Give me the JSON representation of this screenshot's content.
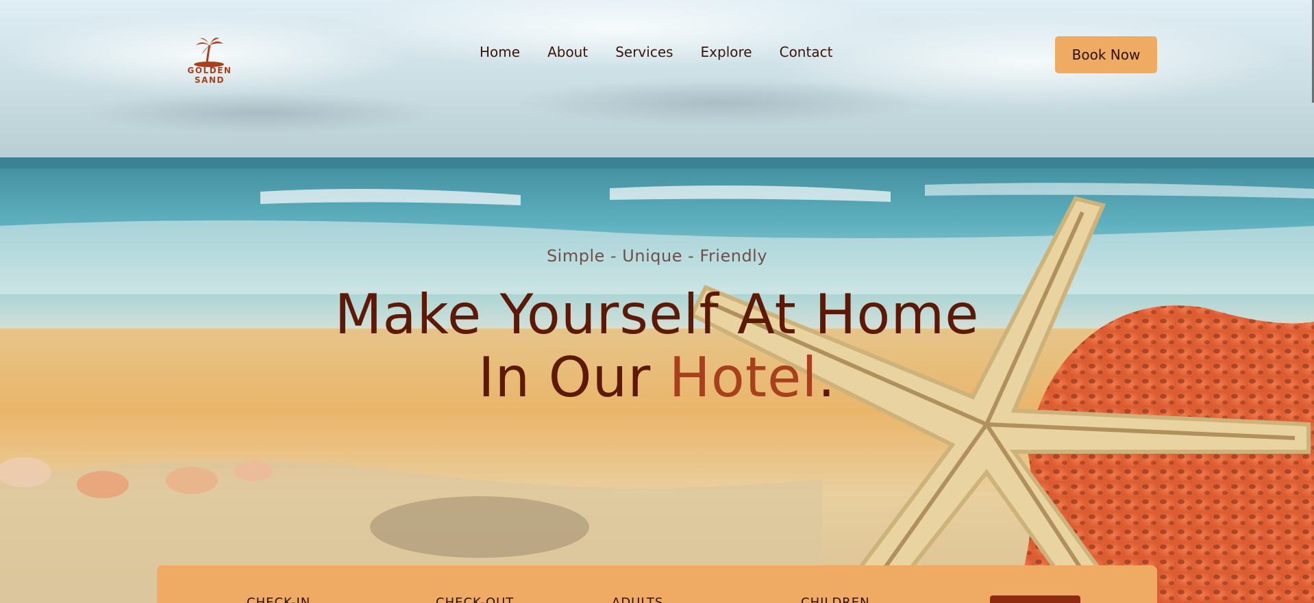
{
  "brand": {
    "name": "GOLDEN SAND",
    "color": "#a6401f",
    "icon": "palm-tree-island-icon"
  },
  "nav": {
    "items": [
      {
        "label": "Home"
      },
      {
        "label": "About"
      },
      {
        "label": "Services"
      },
      {
        "label": "Explore"
      },
      {
        "label": "Contact"
      }
    ],
    "book_label": "Book Now"
  },
  "hero": {
    "tagline": "Simple - Unique - Friendly",
    "headline_line1": "Make Yourself At Home",
    "headline_line2_prefix": "In Our ",
    "headline_accent": "Hotel",
    "headline_end": ".",
    "background": "beach-starfish-coral-photo"
  },
  "booking": {
    "fields": [
      {
        "label": "CHECK-IN"
      },
      {
        "label": "CHECK-OUT"
      },
      {
        "label": "ADULTS"
      },
      {
        "label": "CHILDREN"
      }
    ]
  },
  "colors": {
    "accent": "#f0ab63",
    "headline": "#5c1a06",
    "headline_accent": "#a8401d",
    "button_dark": "#8c2c0f"
  }
}
